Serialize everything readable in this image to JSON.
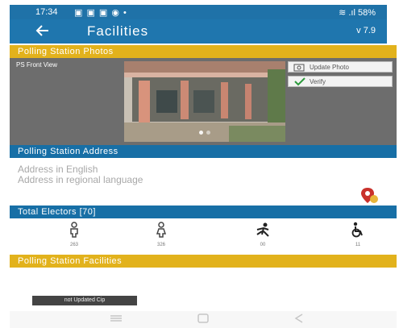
{
  "status_bar": {
    "time": "17:34",
    "notifications": "▣ ▣ ▣ ◉ •",
    "signal": "≋ .ıl 58%"
  },
  "app_bar": {
    "back_icon": "arrow-left",
    "title": "Facilities",
    "version": "v 7.9"
  },
  "photos": {
    "header": "Polling Station Photos",
    "photo_label": "PS Front View",
    "update_button": "Update Photo",
    "verify_button": "Verify"
  },
  "address": {
    "header": "Polling Station Address",
    "line_english": "Address in English",
    "line_regional": "Address in regional language"
  },
  "electors": {
    "header": "Total Electors [70]",
    "groups": [
      {
        "icon": "male-icon",
        "count": "263"
      },
      {
        "icon": "female-icon",
        "count": "326"
      },
      {
        "icon": "senior-icon",
        "count": "00"
      },
      {
        "icon": "wheelchair-icon",
        "count": "11"
      }
    ]
  },
  "facilities": {
    "header": "Polling Station Facilities",
    "toast": "not Updated Cip"
  },
  "colors": {
    "primary": "#1f76ae",
    "accent": "#e2b21c"
  }
}
